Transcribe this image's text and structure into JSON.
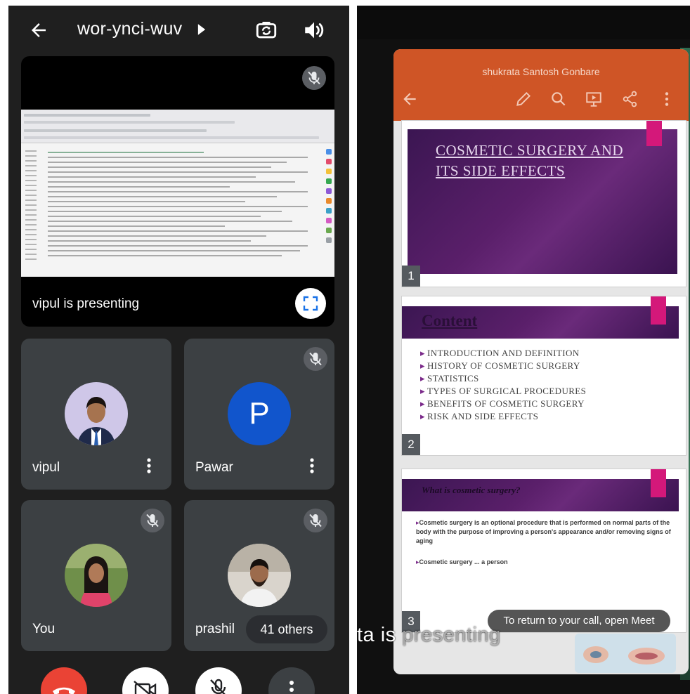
{
  "meet": {
    "meeting_code": "wor-ynci-wuv",
    "presenting_label": "vipul is presenting",
    "participants": [
      {
        "name": "vipul",
        "avatar_initial": ""
      },
      {
        "name": "Pawar",
        "avatar_initial": "P"
      },
      {
        "name": "You",
        "avatar_initial": ""
      },
      {
        "name": "prashil",
        "avatar_initial": ""
      }
    ],
    "others_chip": "41 others",
    "colors": {
      "background": "#1f1f1f",
      "tile": "#3c4043",
      "end_call": "#ea4335",
      "avatar_blue": "#1155cc"
    },
    "icons": [
      "back-arrow-icon",
      "caret-right-icon",
      "flip-camera-icon",
      "speaker-icon",
      "mic-off-icon",
      "fullscreen-icon",
      "more-vert-icon",
      "end-call-icon",
      "camera-off-icon",
      "mic-icon",
      "more-icon"
    ]
  },
  "shared": {
    "presenter_name": "shukrata Santosh Gonbare",
    "slides": [
      {
        "number": "1",
        "title_lines": [
          "COSMETIC SURGERY AND",
          "ITS SIDE EFFECTS"
        ]
      },
      {
        "number": "2",
        "heading": "Content",
        "bullets": [
          "INTRODUCTION AND DEFINITION",
          "HISTORY OF COSMETIC SURGERY",
          "STATISTICS",
          "TYPES OF SURGICAL PROCEDURES",
          "BENEFITS OF COSMETIC SURGERY",
          "RISK AND SIDE EFFECTS"
        ]
      },
      {
        "number": "3",
        "heading": "What is cosmetic surgery?",
        "paragraph": "Cosmetic surgery is an optional procedure that is performed on normal parts of the body with the purpose of improving a person's appearance and/or removing signs of aging",
        "paragraph2": "Cosmetic surgery ... a person"
      }
    ],
    "toast": "To return to your call, open Meet",
    "presenting_fragment_a": "ta is",
    "presenting_fragment_b": " presenting",
    "colors": {
      "header": "#cf5526",
      "banner": "#4a1a5e",
      "accent_pink": "#d4187a"
    },
    "icons": [
      "back-arrow-icon",
      "pen-icon",
      "search-icon",
      "present-icon",
      "share-icon",
      "more-vert-icon"
    ]
  }
}
